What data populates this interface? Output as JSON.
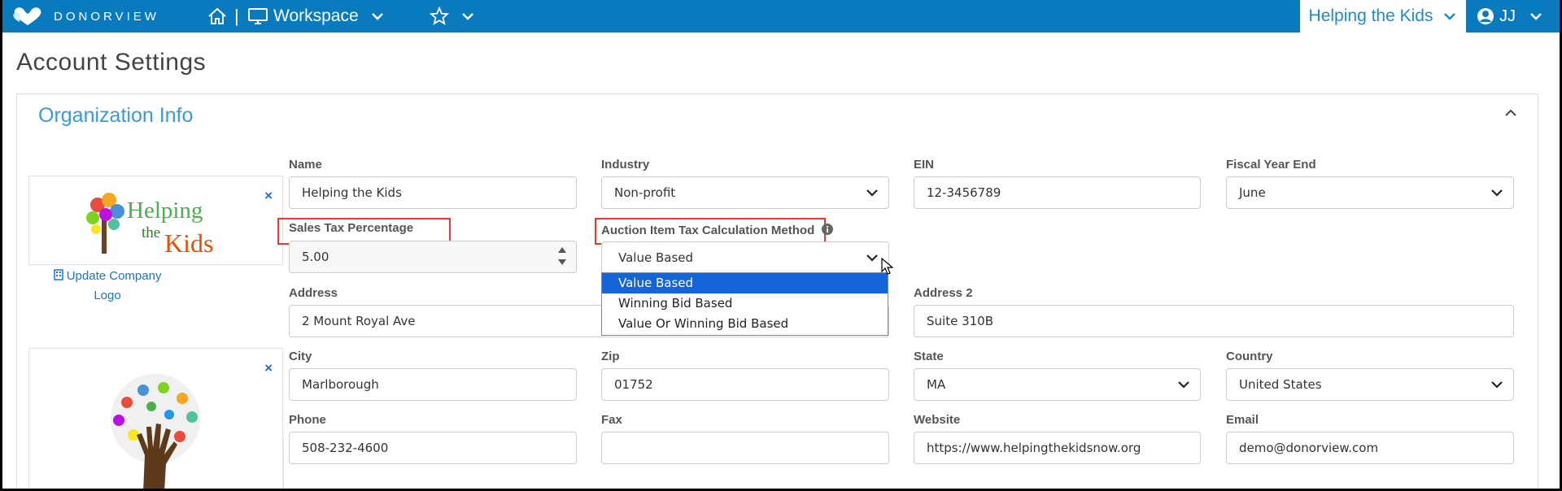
{
  "nav": {
    "logo_text": "DONORVIEW",
    "workspace_label": "Workspace",
    "separator": "|",
    "org_name": "Helping the Kids",
    "user_initials": "JJ"
  },
  "page": {
    "title": "Account Settings"
  },
  "org_info": {
    "section_title": "Organization Info",
    "update_logo_line1": "Update Company",
    "update_logo_line2": "Logo",
    "logo_text_1": "Helping",
    "logo_text_2": "the",
    "logo_text_3": "Kids",
    "remove_symbol": "×",
    "fields": {
      "name": {
        "label": "Name",
        "value": "Helping the Kids"
      },
      "industry": {
        "label": "Industry",
        "value": "Non-profit"
      },
      "ein": {
        "label": "EIN",
        "value": "12-3456789"
      },
      "fiscal_year_end": {
        "label": "Fiscal Year End",
        "value": "June"
      },
      "sales_tax": {
        "label": "Sales Tax Percentage",
        "value": "5.00"
      },
      "auction_tax": {
        "label": "Auction Item Tax Calculation Method",
        "value": "Value Based",
        "options": [
          "Value Based",
          "Winning Bid Based",
          "Value Or Winning Bid Based"
        ]
      },
      "address": {
        "label": "Address",
        "value": "2 Mount Royal Ave"
      },
      "address2": {
        "label": "Address 2",
        "value": "Suite 310B"
      },
      "city": {
        "label": "City",
        "value": "Marlborough"
      },
      "zip": {
        "label": "Zip",
        "value": "01752"
      },
      "state": {
        "label": "State",
        "value": "MA"
      },
      "country": {
        "label": "Country",
        "value": "United States"
      },
      "phone": {
        "label": "Phone",
        "value": "508-232-4600"
      },
      "fax": {
        "label": "Fax",
        "value": ""
      },
      "website": {
        "label": "Website",
        "value": "https://www.helpingthekidsnow.org"
      },
      "email": {
        "label": "Email",
        "value": "demo@donorview.com"
      }
    }
  },
  "colors": {
    "nav_bg": "#0a7abf",
    "accent": "#3b9bd6",
    "link": "#1b75c9",
    "highlight": "#e53935",
    "dropdown_active": "#1565d8"
  },
  "icons": [
    "donorview-logo-icon",
    "home-icon",
    "monitor-icon",
    "chevron-down-icon",
    "star-icon",
    "user-circle-icon",
    "chevron-up-icon",
    "close-icon",
    "building-icon",
    "info-icon",
    "spinner-up-icon",
    "spinner-down-icon",
    "cursor-icon"
  ]
}
